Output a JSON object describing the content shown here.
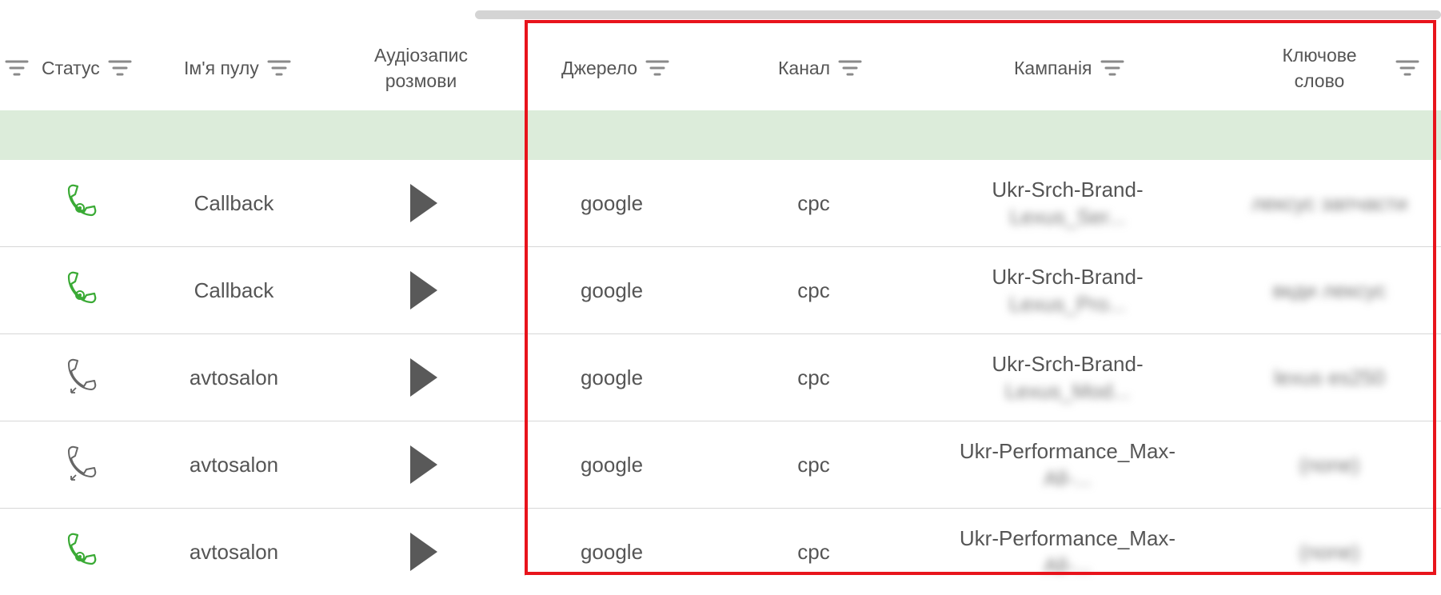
{
  "header": {
    "status_label": "Статус",
    "pool_label": "Ім'я пулу",
    "audio_label_line1": "Аудіозапис",
    "audio_label_line2": "розмови",
    "source_label": "Джерело",
    "channel_label": "Канал",
    "campaign_label": "Кампанія",
    "keyword_label_line1": "Ключове",
    "keyword_label_line2": "слово"
  },
  "colors": {
    "accent_green": "#3aaa35",
    "row_band": "#dcecda",
    "highlight": "#e8141c",
    "icon_gray": "#555555"
  },
  "rows": [
    {
      "status": "callback-icon",
      "pool": "Callback",
      "source": "google",
      "channel": "cpc",
      "campaign_line1": "Ukr-Srch-Brand-",
      "campaign_line2": "Lexus_Ser...",
      "keyword": "лексус запчасти"
    },
    {
      "status": "callback-icon",
      "pool": "Callback",
      "source": "google",
      "channel": "cpc",
      "campaign_line1": "Ukr-Srch-Brand-",
      "campaign_line2": "Lexus_Pro...",
      "keyword": "вкди лексус"
    },
    {
      "status": "phone-incoming-icon",
      "pool": "avtosalon",
      "source": "google",
      "channel": "cpc",
      "campaign_line1": "Ukr-Srch-Brand-",
      "campaign_line2": "Lexus_Mod...",
      "keyword": "lexus es250"
    },
    {
      "status": "phone-incoming-icon",
      "pool": "avtosalon",
      "source": "google",
      "channel": "cpc",
      "campaign_line1": "Ukr-Performance_Max-",
      "campaign_line2": "All-...",
      "keyword": "(none)"
    },
    {
      "status": "callback-icon",
      "pool": "avtosalon",
      "source": "google",
      "channel": "cpc",
      "campaign_line1": "Ukr-Performance_Max-",
      "campaign_line2": "All-...",
      "keyword": "(none)"
    }
  ]
}
